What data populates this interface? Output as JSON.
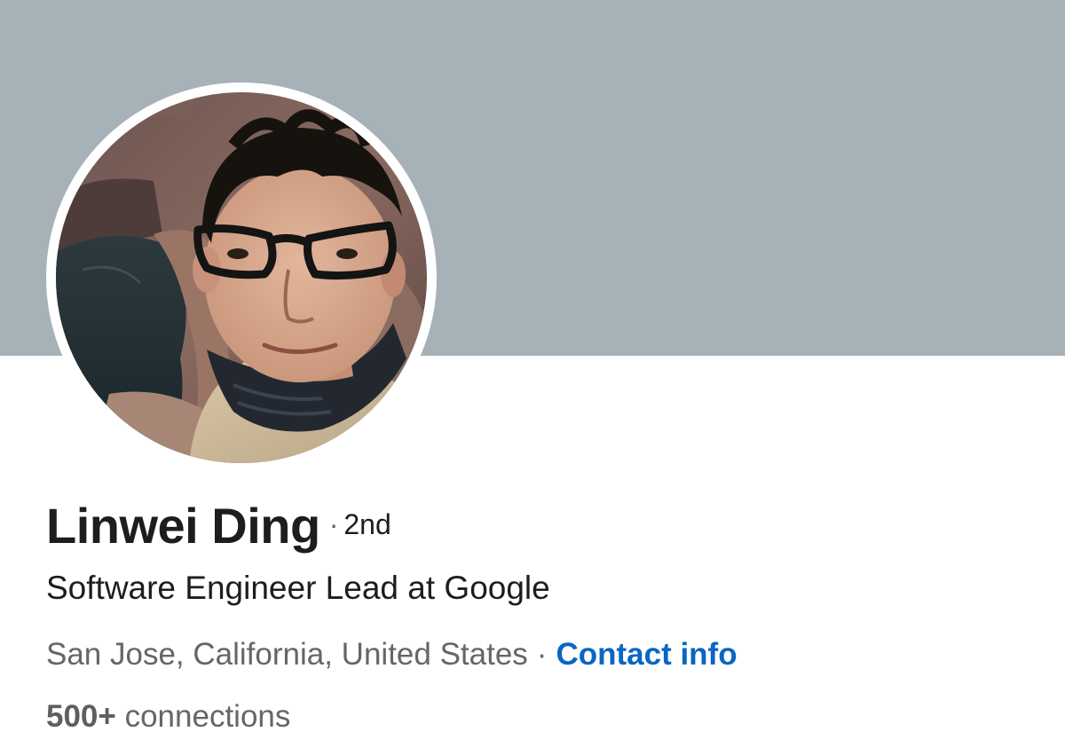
{
  "profile": {
    "name": "Linwei Ding",
    "degree_separator": "·",
    "degree": "2nd",
    "headline": "Software Engineer Lead at Google",
    "location": "San Jose, California, United States",
    "location_separator": "·",
    "contact_label": "Contact info",
    "connections_count": "500+",
    "connections_label": "connections"
  },
  "colors": {
    "cover_background": "#a7b2b8",
    "link": "#0a66c2",
    "primary_text": "#1d1d1d",
    "secondary_text": "#666666"
  },
  "icons": {
    "avatar": "profile-photo"
  }
}
